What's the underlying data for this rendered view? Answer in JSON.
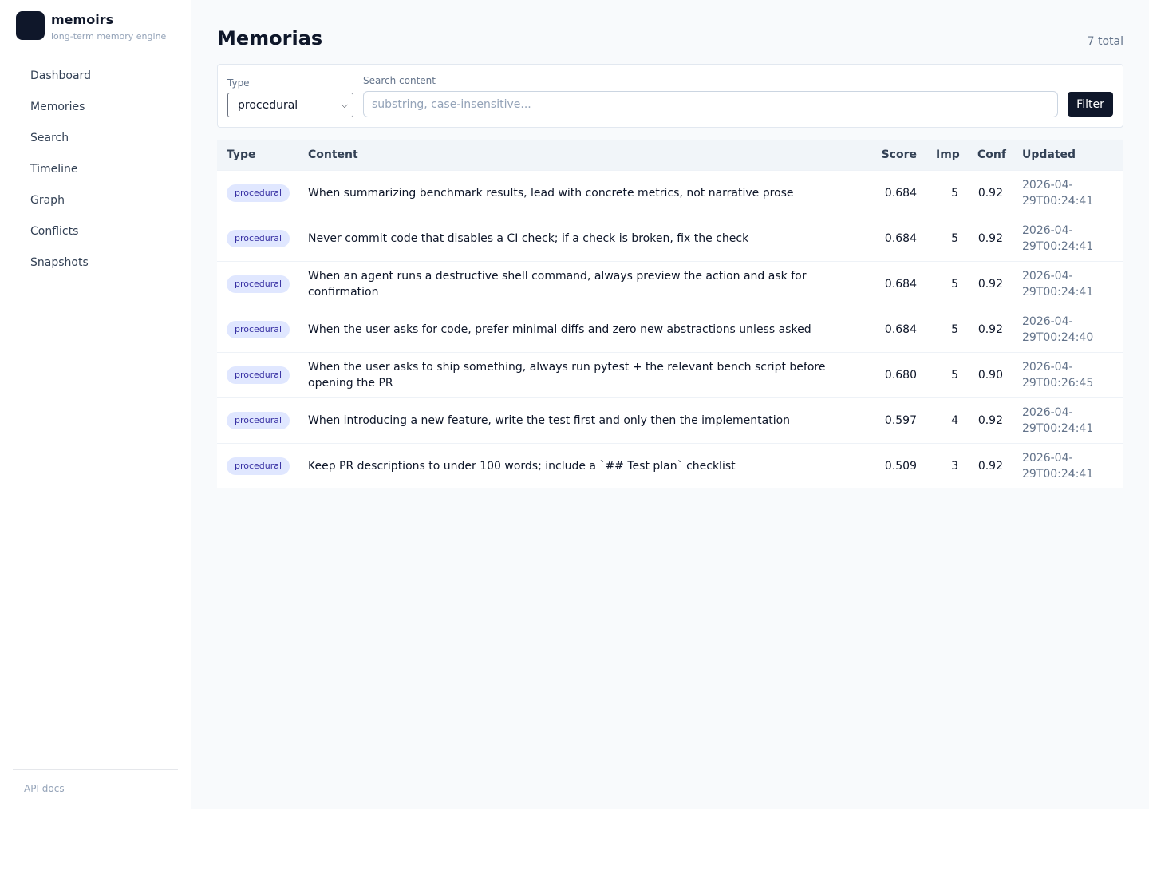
{
  "brand": {
    "name": "memoirs",
    "subtitle": "long-term memory engine"
  },
  "sidebar": {
    "items": [
      {
        "label": "Dashboard"
      },
      {
        "label": "Memories"
      },
      {
        "label": "Search"
      },
      {
        "label": "Timeline"
      },
      {
        "label": "Graph"
      },
      {
        "label": "Conflicts"
      },
      {
        "label": "Snapshots"
      }
    ],
    "footer_link": "API docs"
  },
  "page": {
    "title": "Memorias",
    "count": "7 total"
  },
  "filters": {
    "type_label": "Type",
    "type_value": "procedural",
    "search_label": "Search content",
    "search_placeholder": "substring, case-insensitive...",
    "button_label": "Filter"
  },
  "table": {
    "headers": {
      "type": "Type",
      "content": "Content",
      "score": "Score",
      "imp": "Imp",
      "conf": "Conf",
      "updated": "Updated"
    },
    "rows": [
      {
        "type": "procedural",
        "content": "When summarizing benchmark results, lead with concrete metrics, not narrative prose",
        "score": "0.684",
        "imp": "5",
        "conf": "0.92",
        "updated": "2026-04-29T00:24:41"
      },
      {
        "type": "procedural",
        "content": "Never commit code that disables a CI check; if a check is broken, fix the check",
        "score": "0.684",
        "imp": "5",
        "conf": "0.92",
        "updated": "2026-04-29T00:24:41"
      },
      {
        "type": "procedural",
        "content": "When an agent runs a destructive shell command, always preview the action and ask for confirmation",
        "score": "0.684",
        "imp": "5",
        "conf": "0.92",
        "updated": "2026-04-29T00:24:41"
      },
      {
        "type": "procedural",
        "content": "When the user asks for code, prefer minimal diffs and zero new abstractions unless asked",
        "score": "0.684",
        "imp": "5",
        "conf": "0.92",
        "updated": "2026-04-29T00:24:40"
      },
      {
        "type": "procedural",
        "content": "When the user asks to ship something, always run pytest + the relevant bench script before opening the PR",
        "score": "0.680",
        "imp": "5",
        "conf": "0.90",
        "updated": "2026-04-29T00:26:45"
      },
      {
        "type": "procedural",
        "content": "When introducing a new feature, write the test first and only then the implementation",
        "score": "0.597",
        "imp": "4",
        "conf": "0.92",
        "updated": "2026-04-29T00:24:41"
      },
      {
        "type": "procedural",
        "content": "Keep PR descriptions to under 100 words; include a `## Test plan` checklist",
        "score": "0.509",
        "imp": "3",
        "conf": "0.92",
        "updated": "2026-04-29T00:24:41"
      }
    ]
  }
}
